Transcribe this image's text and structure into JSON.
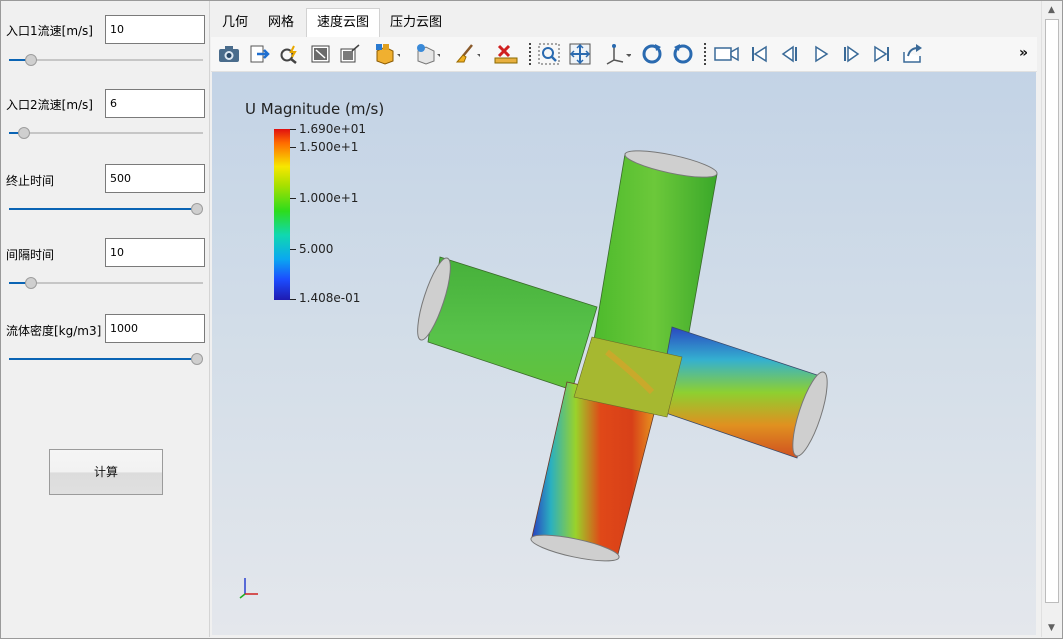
{
  "params": [
    {
      "label": "入口1流速[m/s]",
      "value": "10",
      "slider_fraction": 0.09
    },
    {
      "label": "入口2流速[m/s]",
      "value": "6",
      "slider_fraction": 0.05
    },
    {
      "label": "终止时间",
      "value": "500",
      "slider_fraction": 1.0
    },
    {
      "label": "间隔时间",
      "value": "10",
      "slider_fraction": 0.09
    },
    {
      "label": "流体密度[kg/m3]",
      "value": "1000",
      "slider_fraction": 1.0
    }
  ],
  "calc_button": "计算",
  "tabs": [
    {
      "label": "几何",
      "active": false
    },
    {
      "label": "网格",
      "active": false
    },
    {
      "label": "速度云图",
      "active": true
    },
    {
      "label": "压力云图",
      "active": false
    }
  ],
  "toolbar": {
    "icons": [
      "camera-icon",
      "export-arrow-icon",
      "probe-search-icon",
      "reset-view-icon",
      "zoom-box-icon",
      "cube-display-icon",
      "light-bulb-icon",
      "brush-icon",
      "clear-ruler-icon",
      "zoom-selection-icon",
      "fit-view-icon",
      "axes-orient-icon",
      "rotate-cw-icon",
      "rotate-ccw-icon",
      "video-camera-icon",
      "first-frame-icon",
      "previous-frame-icon",
      "play-icon",
      "next-frame-icon",
      "last-frame-icon",
      "loop-export-icon"
    ],
    "more": "»"
  },
  "viewport": {
    "colorbar_title": "U Magnitude (m/s)",
    "colorbar_labels": [
      "1.690e+01",
      "1.500e+1",
      "1.000e+1",
      "5.000",
      "1.408e-01"
    ],
    "colors": {
      "max": "#e01010",
      "mid": "#2ddc1c",
      "min": "#1e1ab0",
      "background_top": "#c3d3e6",
      "background_bottom": "#e4e7ec"
    }
  }
}
